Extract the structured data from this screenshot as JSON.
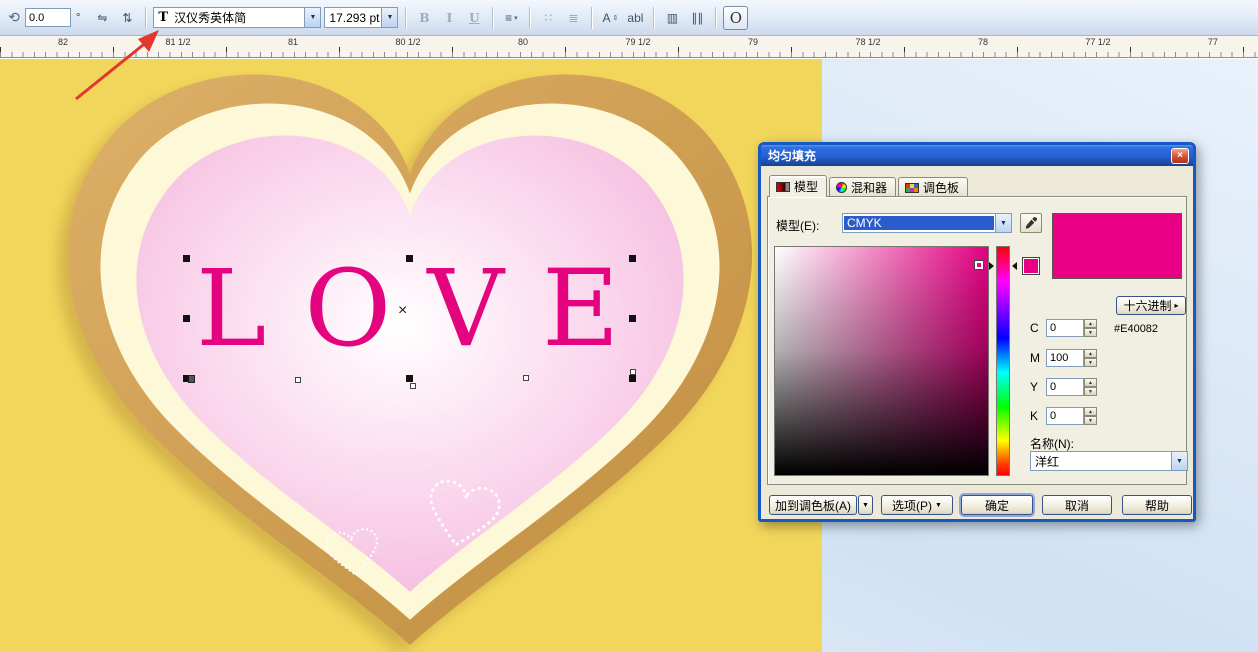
{
  "toolbar": {
    "rotation_value": "0.0",
    "degree_symbol": "°",
    "font_icon": "T",
    "font_name": "汉仪秀英体简",
    "font_size": "17.293 pt",
    "bold_label": "B",
    "italic_label": "I",
    "underline_label": "U",
    "edit_text_label": "abl",
    "o_button_label": "O"
  },
  "icons": {
    "rotate": "⟲",
    "mirror_horizontal": "⇋",
    "mirror_vertical": "⇅",
    "combo_arrow": "▼",
    "menu_arrow": "▾",
    "right_arrow": "▸",
    "spin_up": "▲",
    "spin_down": "▼",
    "align": "≡",
    "bullet_list": "∷",
    "drop_cap": "≣",
    "char_format": "A",
    "char_format_arrows": "⇕",
    "columns": "▥",
    "vertical_text": "∥∥",
    "close": "×"
  },
  "ruler": {
    "labels": [
      "82",
      "81 1/2",
      "81",
      "80 1/2",
      "80",
      "79 1/2",
      "79",
      "78 1/2",
      "78",
      "77 1/2",
      "77"
    ]
  },
  "canvas": {
    "love_text": "LOVE",
    "center_marker": "×",
    "love_color": "#E4047F",
    "page_color": "#F2D65C",
    "heart_outer_color": "#CF9E4F",
    "heart_cream_color": "#FDF8D7",
    "heart_pink_color": "#F5BCE0"
  },
  "dialog": {
    "title": "均匀填充",
    "tabs": [
      {
        "label": "模型"
      },
      {
        "label": "混和器"
      },
      {
        "label": "调色板"
      }
    ],
    "model_label": "模型(E):",
    "model_value": "CMYK",
    "hex_button_label": "十六进制",
    "hex_value": "#E40082",
    "fill_color": "#E40082",
    "cmyk_rows": [
      {
        "label": "C",
        "value": "0"
      },
      {
        "label": "M",
        "value": "100"
      },
      {
        "label": "Y",
        "value": "0"
      },
      {
        "label": "K",
        "value": "0"
      }
    ],
    "name_label": "名称(N):",
    "name_value": "洋红",
    "add_palette_label": "加到调色板(A)",
    "options_label": "选项(P)",
    "ok_label": "确定",
    "cancel_label": "取消",
    "help_label": "帮助"
  }
}
